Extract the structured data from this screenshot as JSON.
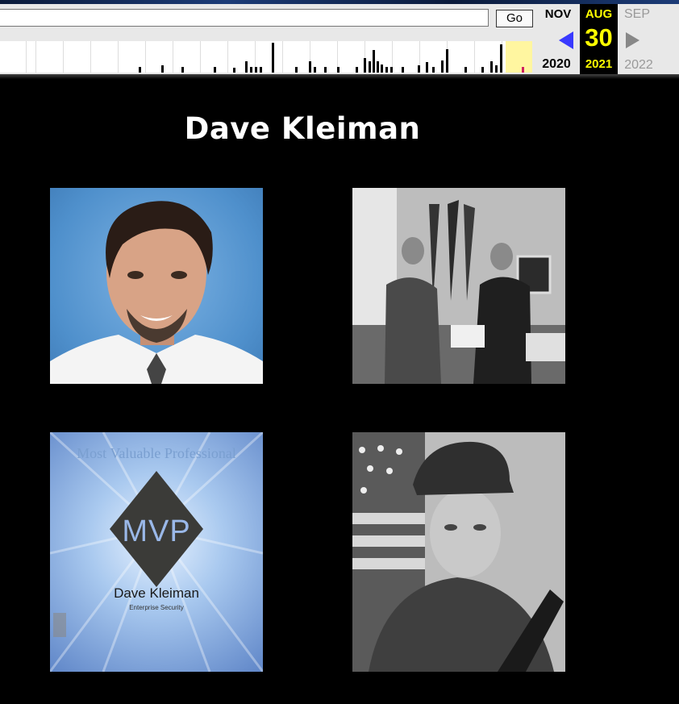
{
  "toolbar": {
    "url_value": "",
    "go_label": "Go",
    "prev_month": "NOV",
    "prev_year": "2020",
    "current_month": "AUG",
    "current_day": "30",
    "current_year": "2021",
    "next_month": "SEP",
    "next_year": "2022"
  },
  "page": {
    "title": "Dave Kleiman"
  },
  "certificate": {
    "heading": "Most Valuable Professional",
    "badge": "MVP",
    "name": "Dave Kleiman",
    "subtitle": "Enterprise Security"
  },
  "colors": {
    "calendar_highlight": "#ffff00",
    "prev_arrow": "#3a3aff",
    "page_background": "#000000"
  }
}
